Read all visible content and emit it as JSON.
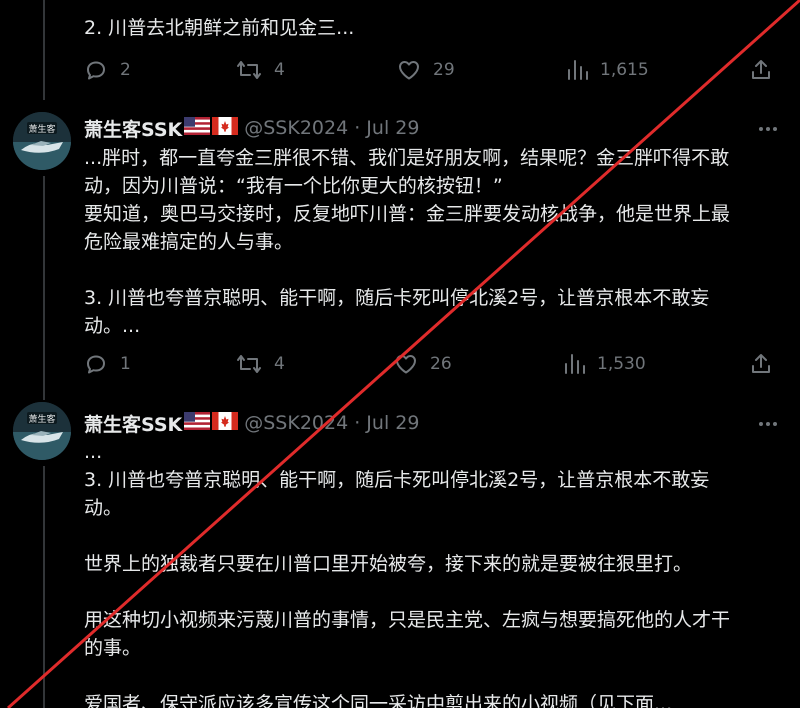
{
  "theme": {
    "background": "#000000",
    "text": "#e7e9ea",
    "muted": "#71767b",
    "divider": "#333639",
    "overlay_line": "#e02b2b"
  },
  "tweet1": {
    "lines": [
      "2. 川普去北朝鲜之前和见金三..."
    ],
    "actions": {
      "reply": {
        "icon": "reply-icon",
        "count": "2"
      },
      "retweet": {
        "icon": "retweet-icon",
        "count": "4"
      },
      "like": {
        "icon": "heart-icon",
        "count": "29"
      },
      "views": {
        "icon": "views-icon",
        "count": "1,615"
      },
      "share": {
        "icon": "share-icon"
      }
    }
  },
  "tweet2": {
    "name": "萧生客SSK",
    "flags": [
      "us-flag-icon",
      "canada-flag-icon"
    ],
    "handle_date": "@SSK2024 · Jul 29",
    "avatar_label": "萧生客",
    "lines": [
      "...胖时，都一直夸金三胖很不错、我们是好朋友啊，结果呢？金三胖吓得不敢",
      "动，因为川普说：“我有一个比你更大的核按钮！”",
      "要知道，奥巴马交接时，反复地吓川普：金三胖要发动核战争，他是世界上最",
      "危险最难搞定的人与事。",
      "",
      "3. 川普也夸普京聪明、能干啊，随后卡死叫停北溪2号，让普京根本不敢妄",
      "动。..."
    ],
    "actions": {
      "reply": {
        "icon": "reply-icon",
        "count": "1"
      },
      "retweet": {
        "icon": "retweet-icon",
        "count": "4"
      },
      "like": {
        "icon": "heart-icon",
        "count": "26"
      },
      "views": {
        "icon": "views-icon",
        "count": "1,530"
      },
      "share": {
        "icon": "share-icon"
      }
    }
  },
  "tweet3": {
    "name": "萧生客SSK",
    "flags": [
      "us-flag-icon",
      "canada-flag-icon"
    ],
    "handle_date": "@SSK2024 · Jul 29",
    "avatar_label": "萧生客",
    "lines": [
      "...",
      "3. 川普也夸普京聪明、能干啊，随后卡死叫停北溪2号，让普京根本不敢妄",
      "动。",
      "",
      "世界上的独裁者只要在川普口里开始被夸，接下来的就是要被往狠里打。",
      "",
      "用这种切小视频来污蔑川普的事情，只是民主党、左疯与想要搞死他的人才干",
      "的事。",
      "",
      "爱国者、保守派应该多宣传这个同一采访中剪出来的小视频（见下面..."
    ]
  }
}
